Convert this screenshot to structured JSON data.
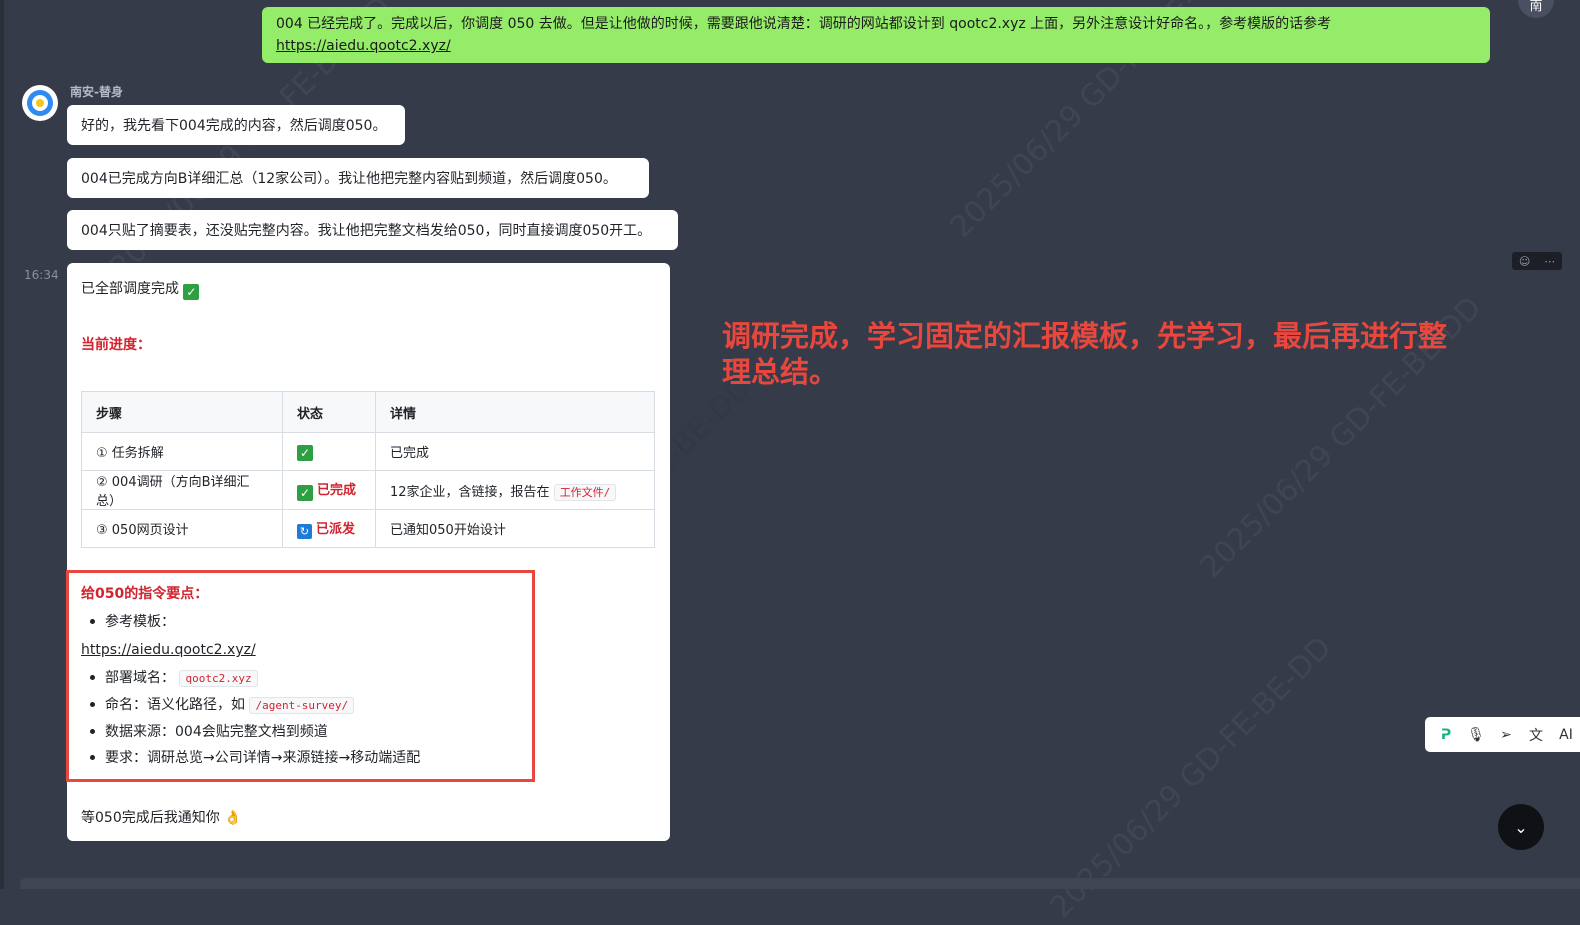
{
  "user_message": {
    "text": "004 已经完成了。完成以后，你调度 050 去做。但是让他做的时候，需要跟他说清楚：调研的网站都设计到 qootc2.xyz 上面，另外注意设计好命名。，参考模版的话参考",
    "link": "https://aiedu.qootc2.xyz/",
    "avatar_label": "南"
  },
  "bot": {
    "name": "南安-替身",
    "messages": [
      "好的，我先看下004完成的内容，然后调度050。",
      "004已完成方向B详细汇总（12家公司）。我让他把完整内容贴到频道，然后调度050。",
      "004只贴了摘要表，还没贴完整内容。我让他把完整文档发给050，同时直接调度050开工。"
    ]
  },
  "report": {
    "time": "16:34",
    "done_line": "已全部调度完成",
    "progress_heading": "当前进度：",
    "table": {
      "headers": [
        "步骤",
        "状态",
        "详情"
      ],
      "rows": [
        {
          "step": "① 任务拆解",
          "status_icon": "check-icon",
          "status_text": "",
          "detail": "已完成",
          "detail_code": ""
        },
        {
          "step": "② 004调研（方向B详细汇总）",
          "status_icon": "check-icon",
          "status_text": "已完成",
          "detail": "12家企业，含链接，报告在",
          "detail_code": "工作文件/"
        },
        {
          "step": "③ 050网页设计",
          "status_icon": "sync-icon",
          "status_text": "已派发",
          "detail": "已通知050开始设计",
          "detail_code": ""
        }
      ]
    },
    "instructions_heading": "给050的指令要点：",
    "ref_label": "参考模板：",
    "ref_link": "https://aiedu.qootc2.xyz/",
    "domain_label": "部署域名：",
    "domain_code": "qootc2.xyz",
    "naming_label": "命名：语义化路径，如",
    "naming_code": "/agent-survey/",
    "source_item": "数据来源：004会贴完整文档到频道",
    "requirement_item": "要求：调研总览→公司详情→来源链接→移动端适配",
    "footer": "等050完成后我通知你 👌"
  },
  "annotation": "调研完成，学习固定的汇报模板，先学习，最后再进行整理总结。",
  "toolbar": {
    "items": [
      "logo-icon",
      "mic-icon",
      "send-icon",
      "translate-icon",
      "ai-icon"
    ],
    "ai_label": "AI"
  },
  "colors": {
    "background": "#353b48",
    "user_bubble": "#95ec69",
    "annotation": "#e8473e",
    "status_red": "#d1242f"
  }
}
